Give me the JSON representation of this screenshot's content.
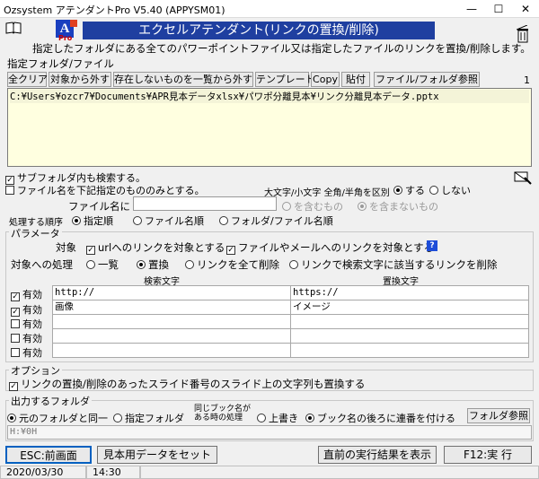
{
  "window": {
    "title": "Ozsystem アテンダントPro V5.40 (APPYSM01)",
    "minimize": "—",
    "maximize": "☐",
    "close": "✕"
  },
  "header": {
    "logo_text": "A",
    "logo_sub": "Pro",
    "title": "エクセルアテンダント(リンクの置換/削除)",
    "description": "指定したフォルダにある全てのパワーポイントファイル又は指定したファイルのリンクを置換/削除します。"
  },
  "target": {
    "label": "指定フォルダ/ファイル",
    "count": "1",
    "buttons": [
      "全クリア",
      "対象から外す",
      "存在しないものを一覧から外す",
      "テンプレート",
      "Copy",
      "貼付",
      "ファイル/フォルダ参照"
    ],
    "path": "C:¥Users¥ozcr7¥Documents¥APR見本データxlsx¥パワポ分離見本¥リンク分離見本データ.pptx"
  },
  "options_top": {
    "subfolder": "サブフォルダ内も検索する。",
    "filename_only": "ファイル名を下記指定のもののみとする。",
    "case_label": "大文字/小文字 全角/半角を区別",
    "case_yes": "する",
    "case_no": "しない",
    "filename_label": "ファイル名に",
    "filename_value": "",
    "contain": "を含むもの",
    "not_contain": "を含まないもの",
    "order_label": "処理する順序",
    "order_options": [
      "指定順",
      "ファイル名順",
      "フォルダ/ファイル名順"
    ]
  },
  "params": {
    "group": "パラメータ",
    "target_label": "対象",
    "target_url": "urlへのリンクを対象とする",
    "target_file": "ファイルやメールへのリンクを対象とする",
    "help": "?",
    "process_label": "対象への処理",
    "process_options": [
      "一覧",
      "置換",
      "リンクを全て削除",
      "リンクで検索文字に該当するリンクを削除"
    ],
    "col_search": "検索文字",
    "col_replace": "置換文字",
    "rows": [
      {
        "enabled": "有効",
        "checked": true,
        "search": "http://",
        "replace": "https://"
      },
      {
        "enabled": "有効",
        "checked": true,
        "search": "画像",
        "replace": "イメージ"
      },
      {
        "enabled": "有効",
        "checked": false,
        "search": "",
        "replace": ""
      },
      {
        "enabled": "有効",
        "checked": false,
        "search": "",
        "replace": ""
      },
      {
        "enabled": "有効",
        "checked": false,
        "search": "",
        "replace": ""
      }
    ]
  },
  "option": {
    "group": "オプション",
    "replace_text": "リンクの置換/削除のあったスライド番号のスライド上の文字列も置換する"
  },
  "output": {
    "group": "出力するフォルダ",
    "same": "元のフォルダと同一",
    "specified": "指定フォルダ",
    "same_book_1": "同じブック名が",
    "same_book_2": "ある時の処理",
    "overwrite": "上書き",
    "suffix": "ブック名の後ろに連番を付ける",
    "browse": "フォルダ参照",
    "path": "H:¥0H"
  },
  "footer": {
    "esc": "ESC:前画面",
    "sample": "見本用データをセット",
    "last_result": "直前の実行結果を表示",
    "f12": "F12:実 行"
  },
  "status": {
    "date": "2020/03/30",
    "time": "14:30"
  },
  "colors": {
    "header_bg": "#1f3fa0",
    "path_bg": "#ffffe0",
    "help_bg": "#1e4dd8"
  }
}
